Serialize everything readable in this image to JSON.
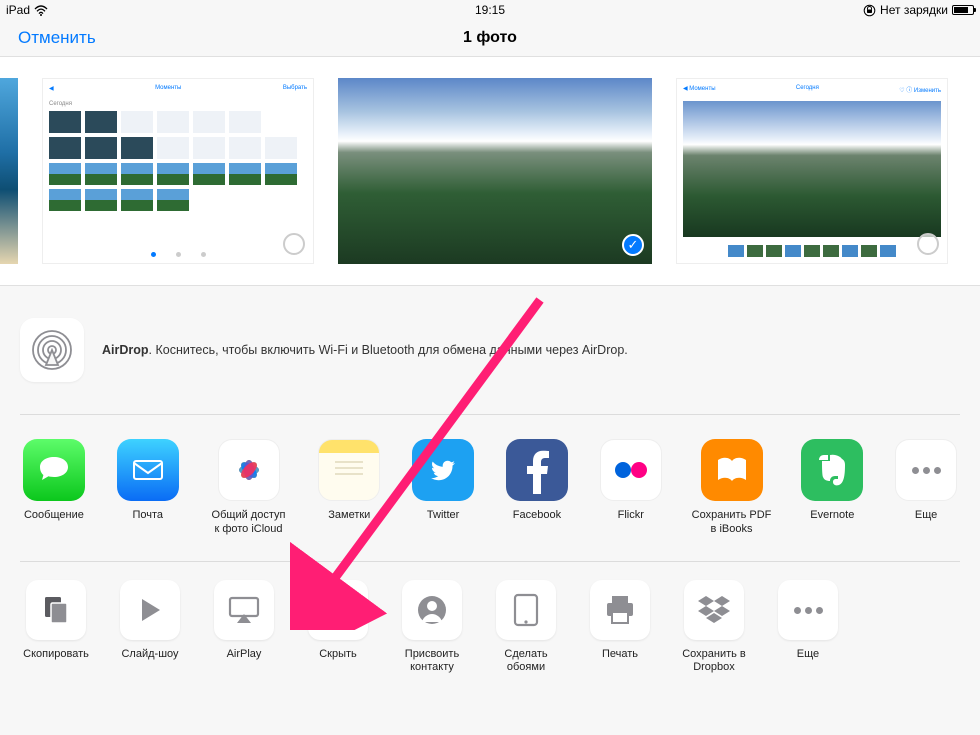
{
  "status": {
    "device": "iPad",
    "time": "19:15",
    "charge_text": "Нет зарядки"
  },
  "nav": {
    "cancel": "Отменить",
    "title": "1 фото"
  },
  "airdrop": {
    "bold": "AirDrop",
    "text": ". Коснитесь, чтобы включить Wi-Fi и Bluetooth для обмена данными через AirDrop."
  },
  "apps": {
    "message": "Сообщение",
    "mail": "Почта",
    "icloud": "Общий доступ\nк фото iCloud",
    "notes": "Заметки",
    "twitter": "Twitter",
    "facebook": "Facebook",
    "flickr": "Flickr",
    "ibooks": "Сохранить PDF\nв iBooks",
    "evernote": "Evernote",
    "more": "Еще"
  },
  "actions": {
    "copy": "Скопировать",
    "slideshow": "Слайд-шоу",
    "airplay": "AirPlay",
    "hide": "Скрыть",
    "contact": "Присвоить\nконтакту",
    "wallpaper": "Сделать\nобоями",
    "print": "Печать",
    "dropbox": "Сохранить в\nDropbox",
    "more": "Еще"
  }
}
